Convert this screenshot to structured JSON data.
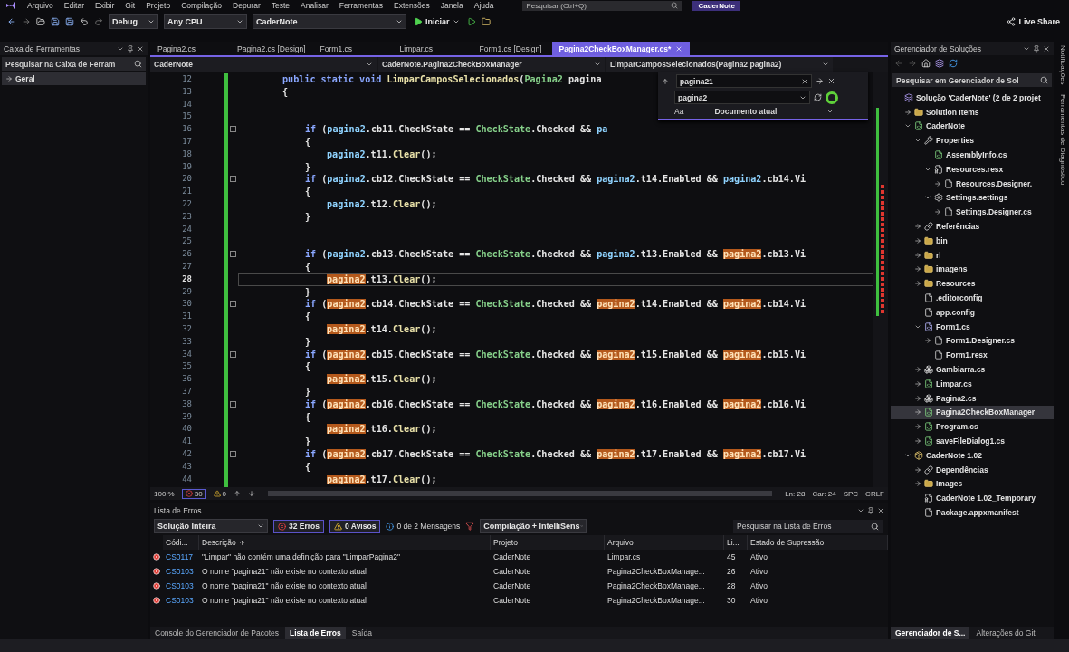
{
  "menu": {
    "items": [
      "Arquivo",
      "Editar",
      "Exibir",
      "Git",
      "Projeto",
      "Compilação",
      "Depurar",
      "Teste",
      "Analisar",
      "Ferramentas",
      "Extensões",
      "Janela",
      "Ajuda"
    ],
    "search": {
      "placeholder": "Pesquisar (Ctrl+Q)"
    },
    "solution_badge": "CaderNote"
  },
  "toolbar": {
    "configuration": "Debug",
    "platform": "Any CPU",
    "startup_project": "CaderNote",
    "start_label": "Iniciar",
    "live_share": "Live Share"
  },
  "toolbox": {
    "title": "Caixa de Ferramentas",
    "search": {
      "placeholder": "Pesquisar na Caixa de Ferram"
    },
    "groups": [
      {
        "label": "Geral",
        "expanded": false
      }
    ]
  },
  "editor": {
    "tabs": [
      {
        "label": "Pagina2.cs",
        "selected": false
      },
      {
        "label": "Pagina2.cs [Design]",
        "selected": false
      },
      {
        "label": "Form1.cs",
        "selected": false
      },
      {
        "label": "Limpar.cs",
        "selected": false
      },
      {
        "label": "Form1.cs [Design]",
        "selected": false
      },
      {
        "label": "Pagina2CheckBoxManager.cs*",
        "selected": true
      }
    ],
    "nav": [
      "CaderNote",
      "CaderNote.Pagina2CheckBoxManager",
      "LimparCamposSelecionados(Pagina2 pagina2)"
    ],
    "lines": [
      {
        "n": "12",
        "kind": "member",
        "current": false,
        "fold": false,
        "tokens": [
          {
            "kind": "keyword",
            "text": "public static void "
          },
          {
            "kind": "method",
            "text": "LimparCamposSelecionados"
          },
          {
            "kind": "plain",
            "text": "("
          },
          {
            "kind": "type",
            "text": "Pagina2"
          },
          {
            "kind": "plain",
            "text": " pagina"
          }
        ]
      },
      {
        "n": "13",
        "kind": "member",
        "current": false,
        "fold": false,
        "tokens": [
          {
            "kind": "plain",
            "text": "{"
          }
        ]
      },
      {
        "n": "14",
        "kind": "blank",
        "current": false,
        "fold": false
      },
      {
        "n": "15",
        "kind": "blank",
        "current": false,
        "fold": false
      },
      {
        "n": "16",
        "kind": "block",
        "current": false,
        "fold": true,
        "tokens": [
          {
            "kind": "keyword",
            "text": "if"
          },
          {
            "kind": "plain",
            "text": " ("
          },
          {
            "kind": "variable",
            "text": "pagina2"
          },
          {
            "kind": "plain",
            "text": ".cb11.CheckState == "
          },
          {
            "kind": "type",
            "text": "CheckState"
          },
          {
            "kind": "plain",
            "text": ".Checked && "
          },
          {
            "kind": "variable",
            "text": "pa"
          }
        ]
      },
      {
        "n": "17",
        "kind": "block",
        "current": false,
        "fold": false,
        "tokens": [
          {
            "kind": "plain",
            "text": "{"
          }
        ]
      },
      {
        "n": "18",
        "kind": "body",
        "current": false,
        "fold": false,
        "tokens": [
          {
            "kind": "variable",
            "text": "pagina2"
          },
          {
            "kind": "plain",
            "text": ".t11."
          },
          {
            "kind": "method",
            "text": "Clear"
          },
          {
            "kind": "plain",
            "text": "();"
          }
        ]
      },
      {
        "n": "19",
        "kind": "block",
        "current": false,
        "fold": false,
        "tokens": [
          {
            "kind": "plain",
            "text": "}"
          }
        ]
      },
      {
        "n": "20",
        "kind": "block",
        "current": false,
        "fold": true,
        "tokens": [
          {
            "kind": "keyword",
            "text": "if"
          },
          {
            "kind": "plain",
            "text": " ("
          },
          {
            "kind": "variable",
            "text": "pagina2"
          },
          {
            "kind": "plain",
            "text": ".cb12.CheckState == "
          },
          {
            "kind": "type",
            "text": "CheckState"
          },
          {
            "kind": "plain",
            "text": ".Checked && "
          },
          {
            "kind": "variable",
            "text": "pagina2"
          },
          {
            "kind": "plain",
            "text": ".t14.Enabled && "
          },
          {
            "kind": "variable",
            "text": "pagina2"
          },
          {
            "kind": "plain",
            "text": ".cb14.Vi"
          }
        ]
      },
      {
        "n": "21",
        "kind": "block",
        "current": false,
        "fold": false,
        "tokens": [
          {
            "kind": "plain",
            "text": "{"
          }
        ]
      },
      {
        "n": "22",
        "kind": "body",
        "current": false,
        "fold": false,
        "tokens": [
          {
            "kind": "variable",
            "text": "pagina2"
          },
          {
            "kind": "plain",
            "text": ".t12."
          },
          {
            "kind": "method",
            "text": "Clear"
          },
          {
            "kind": "plain",
            "text": "();"
          }
        ]
      },
      {
        "n": "23",
        "kind": "block",
        "current": false,
        "fold": false,
        "tokens": [
          {
            "kind": "plain",
            "text": "}"
          }
        ]
      },
      {
        "n": "24",
        "kind": "blank",
        "current": false,
        "fold": false
      },
      {
        "n": "25",
        "kind": "blank",
        "current": false,
        "fold": false
      },
      {
        "n": "26",
        "kind": "block",
        "current": false,
        "fold": true,
        "tokens": [
          {
            "kind": "keyword",
            "text": "if"
          },
          {
            "kind": "plain",
            "text": " ("
          },
          {
            "kind": "variable",
            "text": "pagina2"
          },
          {
            "kind": "plain",
            "text": ".cb13.CheckState == "
          },
          {
            "kind": "type",
            "text": "CheckState"
          },
          {
            "kind": "plain",
            "text": ".Checked && "
          },
          {
            "kind": "variable",
            "text": "pagina2"
          },
          {
            "kind": "plain",
            "text": ".t13.Enabled && "
          },
          {
            "kind": "match",
            "text": "pagina2"
          },
          {
            "kind": "plain",
            "text": ".cb13.Vi"
          }
        ]
      },
      {
        "n": "27",
        "kind": "block",
        "current": false,
        "fold": false,
        "tokens": [
          {
            "kind": "plain",
            "text": "{"
          }
        ]
      },
      {
        "n": "28",
        "kind": "body",
        "current": true,
        "fold": false,
        "tokens": [
          {
            "kind": "match",
            "text": "pagina2"
          },
          {
            "kind": "plain",
            "text": ".t13."
          },
          {
            "kind": "method",
            "text": "Clear"
          },
          {
            "kind": "plain",
            "text": "();"
          }
        ]
      },
      {
        "n": "29",
        "kind": "block",
        "current": false,
        "fold": false,
        "tokens": [
          {
            "kind": "plain",
            "text": "}"
          }
        ]
      },
      {
        "n": "30",
        "kind": "block",
        "current": false,
        "fold": true,
        "tokens": [
          {
            "kind": "keyword",
            "text": "if"
          },
          {
            "kind": "plain",
            "text": " ("
          },
          {
            "kind": "match",
            "text": "pagina2"
          },
          {
            "kind": "plain",
            "text": ".cb14.CheckState == "
          },
          {
            "kind": "type",
            "text": "CheckState"
          },
          {
            "kind": "plain",
            "text": ".Checked && "
          },
          {
            "kind": "match",
            "text": "pagina2"
          },
          {
            "kind": "plain",
            "text": ".t14.Enabled && "
          },
          {
            "kind": "match",
            "text": "pagina2"
          },
          {
            "kind": "plain",
            "text": ".cb14.Vi"
          }
        ]
      },
      {
        "n": "31",
        "kind": "block",
        "current": false,
        "fold": false,
        "tokens": [
          {
            "kind": "plain",
            "text": "{"
          }
        ]
      },
      {
        "n": "32",
        "kind": "body",
        "current": false,
        "fold": false,
        "tokens": [
          {
            "kind": "match",
            "text": "pagina2"
          },
          {
            "kind": "plain",
            "text": ".t14."
          },
          {
            "kind": "method",
            "text": "Clear"
          },
          {
            "kind": "plain",
            "text": "();"
          }
        ]
      },
      {
        "n": "33",
        "kind": "block",
        "current": false,
        "fold": false,
        "tokens": [
          {
            "kind": "plain",
            "text": "}"
          }
        ]
      },
      {
        "n": "34",
        "kind": "block",
        "current": false,
        "fold": true,
        "tokens": [
          {
            "kind": "keyword",
            "text": "if"
          },
          {
            "kind": "plain",
            "text": " ("
          },
          {
            "kind": "match",
            "text": "pagina2"
          },
          {
            "kind": "plain",
            "text": ".cb15.CheckState == "
          },
          {
            "kind": "type",
            "text": "CheckState"
          },
          {
            "kind": "plain",
            "text": ".Checked && "
          },
          {
            "kind": "match",
            "text": "pagina2"
          },
          {
            "kind": "plain",
            "text": ".t15.Enabled && "
          },
          {
            "kind": "match",
            "text": "pagina2"
          },
          {
            "kind": "plain",
            "text": ".cb15.Vi"
          }
        ]
      },
      {
        "n": "35",
        "kind": "block",
        "current": false,
        "fold": false,
        "tokens": [
          {
            "kind": "plain",
            "text": "{"
          }
        ]
      },
      {
        "n": "36",
        "kind": "body",
        "current": false,
        "fold": false,
        "tokens": [
          {
            "kind": "match",
            "text": "pagina2"
          },
          {
            "kind": "plain",
            "text": ".t15."
          },
          {
            "kind": "method",
            "text": "Clear"
          },
          {
            "kind": "plain",
            "text": "();"
          }
        ]
      },
      {
        "n": "37",
        "kind": "block",
        "current": false,
        "fold": false,
        "tokens": [
          {
            "kind": "plain",
            "text": "}"
          }
        ]
      },
      {
        "n": "38",
        "kind": "block",
        "current": false,
        "fold": true,
        "tokens": [
          {
            "kind": "keyword",
            "text": "if"
          },
          {
            "kind": "plain",
            "text": " ("
          },
          {
            "kind": "match",
            "text": "pagina2"
          },
          {
            "kind": "plain",
            "text": ".cb16.CheckState == "
          },
          {
            "kind": "type",
            "text": "CheckState"
          },
          {
            "kind": "plain",
            "text": ".Checked && "
          },
          {
            "kind": "match",
            "text": "pagina2"
          },
          {
            "kind": "plain",
            "text": ".t16.Enabled && "
          },
          {
            "kind": "match",
            "text": "pagina2"
          },
          {
            "kind": "plain",
            "text": ".cb16.Vi"
          }
        ]
      },
      {
        "n": "39",
        "kind": "block",
        "current": false,
        "fold": false,
        "tokens": [
          {
            "kind": "plain",
            "text": "{"
          }
        ]
      },
      {
        "n": "40",
        "kind": "body",
        "current": false,
        "fold": false,
        "tokens": [
          {
            "kind": "match",
            "text": "pagina2"
          },
          {
            "kind": "plain",
            "text": ".t16."
          },
          {
            "kind": "method",
            "text": "Clear"
          },
          {
            "kind": "plain",
            "text": "();"
          }
        ]
      },
      {
        "n": "41",
        "kind": "block",
        "current": false,
        "fold": false,
        "tokens": [
          {
            "kind": "plain",
            "text": "}"
          }
        ]
      },
      {
        "n": "42",
        "kind": "block",
        "current": false,
        "fold": true,
        "tokens": [
          {
            "kind": "keyword",
            "text": "if"
          },
          {
            "kind": "plain",
            "text": " ("
          },
          {
            "kind": "match",
            "text": "pagina2"
          },
          {
            "kind": "plain",
            "text": ".cb17.CheckState == "
          },
          {
            "kind": "type",
            "text": "CheckState"
          },
          {
            "kind": "plain",
            "text": ".Checked && "
          },
          {
            "kind": "match",
            "text": "pagina2"
          },
          {
            "kind": "plain",
            "text": ".t17.Enabled && "
          },
          {
            "kind": "match",
            "text": "pagina2"
          },
          {
            "kind": "plain",
            "text": ".cb17.Vi"
          }
        ]
      },
      {
        "n": "43",
        "kind": "block",
        "current": false,
        "fold": false,
        "tokens": [
          {
            "kind": "plain",
            "text": "{"
          }
        ]
      },
      {
        "n": "44",
        "kind": "body",
        "current": false,
        "fold": false,
        "tokens": [
          {
            "kind": "match",
            "text": "pagina2"
          },
          {
            "kind": "plain",
            "text": ".t17."
          },
          {
            "kind": "method",
            "text": "Clear"
          },
          {
            "kind": "plain",
            "text": "();"
          }
        ]
      }
    ],
    "find": {
      "find_value": "pagina21",
      "replace_value": "pagina2",
      "match_case": "Aa",
      "scope": "Documento atual"
    },
    "status": {
      "zoom": "100 %",
      "errors": "30",
      "warnings": "0",
      "line": "Ln: 28",
      "column": "Car: 24",
      "spacing": "SPC",
      "line_ending": "CRLF"
    }
  },
  "error_list": {
    "title": "Lista de Erros",
    "scope": "Solução Inteira",
    "errors": "32 Erros",
    "warnings": "0 Avisos",
    "messages": "0 de 2 Mensagens",
    "source": "Compilação + IntelliSens",
    "search": {
      "placeholder": "Pesquisar na Lista de Erros"
    },
    "columns": [
      "Códi...",
      "Descrição",
      "Projeto",
      "Arquivo",
      "Li...",
      "Estado de Supressão"
    ],
    "rows": [
      {
        "code": "CS0117",
        "description": "\"Limpar\" não contém uma definição para \"LimparPagina2\"",
        "project": "CaderNote",
        "file": "Limpar.cs",
        "line": "45",
        "state": "Ativo"
      },
      {
        "code": "CS0103",
        "description": "O nome \"pagina21\" não existe no contexto atual",
        "project": "CaderNote",
        "file": "Pagina2CheckBoxManage...",
        "line": "26",
        "state": "Ativo"
      },
      {
        "code": "CS0103",
        "description": "O nome \"pagina21\" não existe no contexto atual",
        "project": "CaderNote",
        "file": "Pagina2CheckBoxManage...",
        "line": "28",
        "state": "Ativo"
      },
      {
        "code": "CS0103",
        "description": "O nome \"pagina21\" não existe no contexto atual",
        "project": "CaderNote",
        "file": "Pagina2CheckBoxManage...",
        "line": "30",
        "state": "Ativo"
      }
    ],
    "bottom_tabs": [
      {
        "label": "Console do Gerenciador de Pacotes",
        "selected": false
      },
      {
        "label": "Lista de Erros",
        "selected": true
      },
      {
        "label": "Saída",
        "selected": false
      }
    ]
  },
  "solution_explorer": {
    "title": "Gerenciador de Soluções",
    "search": {
      "placeholder": "Pesquisar em Gerenciador de Sol"
    },
    "tree": [
      {
        "label": "Solução 'CaderNote' (2 de 2 projet",
        "kind": "solution",
        "selected": false,
        "children": [
          {
            "label": "Solution Items",
            "kind": "folder",
            "selected": false,
            "expanded": false
          },
          {
            "label": "CaderNote",
            "kind": "project",
            "selected": false,
            "expanded": true,
            "children": [
              {
                "label": "Properties",
                "kind": "wrench",
                "selected": false,
                "expanded": true,
                "children": [
                  {
                    "label": "AssemblyInfo.cs",
                    "kind": "cs",
                    "selected": false
                  },
                  {
                    "label": "Resources.resx",
                    "kind": "resx",
                    "selected": false,
                    "expanded": true,
                    "children": [
                      {
                        "label": "Resources.Designer.",
                        "kind": "file",
                        "selected": false,
                        "expanded": false
                      }
                    ]
                  },
                  {
                    "label": "Settings.settings",
                    "kind": "settings",
                    "selected": false,
                    "expanded": true,
                    "children": [
                      {
                        "label": "Settings.Designer.cs",
                        "kind": "file",
                        "selected": false,
                        "expanded": false
                      }
                    ]
                  }
                ]
              },
              {
                "label": "Referências",
                "kind": "refs",
                "selected": false,
                "expanded": false
              },
              {
                "label": "bin",
                "kind": "folder",
                "selected": false,
                "expanded": false
              },
              {
                "label": "rl",
                "kind": "folder",
                "selected": false,
                "expanded": false
              },
              {
                "label": "imagens",
                "kind": "folder",
                "selected": false,
                "expanded": false
              },
              {
                "label": "Resources",
                "kind": "folder",
                "selected": false,
                "expanded": false
              },
              {
                "label": ".editorconfig",
                "kind": "config",
                "selected": false
              },
              {
                "label": "app.config",
                "kind": "config",
                "selected": false
              },
              {
                "label": "Form1.cs",
                "kind": "form",
                "selected": false,
                "expanded": true,
                "children": [
                  {
                    "label": "Form1.Designer.cs",
                    "kind": "file",
                    "selected": false,
                    "expanded": false
                  },
                  {
                    "label": "Form1.resx",
                    "kind": "file",
                    "selected": false
                  }
                ]
              },
              {
                "label": "Gambiarra.cs",
                "kind": "class",
                "selected": false,
                "expanded": false
              },
              {
                "label": "Limpar.cs",
                "kind": "cs",
                "selected": false,
                "expanded": false
              },
              {
                "label": "Pagina2.cs",
                "kind": "class",
                "selected": false,
                "expanded": false
              },
              {
                "label": "Pagina2CheckBoxManager",
                "kind": "cs",
                "selected": true,
                "expanded": false
              },
              {
                "label": "Program.cs",
                "kind": "cs",
                "selected": false,
                "expanded": false
              },
              {
                "label": "saveFileDialog1.cs",
                "kind": "cs",
                "selected": false,
                "expanded": false
              }
            ]
          },
          {
            "label": "CaderNote 1.02",
            "kind": "package",
            "selected": false,
            "expanded": true,
            "children": [
              {
                "label": "Dependências",
                "kind": "refs",
                "selected": false,
                "expanded": false
              },
              {
                "label": "Images",
                "kind": "folder",
                "selected": false,
                "expanded": false
              },
              {
                "label": "CaderNote 1.02_Temporary",
                "kind": "cert",
                "selected": false
              },
              {
                "label": "Package.appxmanifest",
                "kind": "manifest",
                "selected": false
              }
            ]
          }
        ]
      }
    ],
    "bottom_tabs": [
      {
        "label": "Gerenciador de S...",
        "selected": true
      },
      {
        "label": "Alterações do Git",
        "selected": false
      }
    ]
  },
  "side_strip": [
    "Notificações",
    "Ferramentas de Diagnóstico"
  ]
}
